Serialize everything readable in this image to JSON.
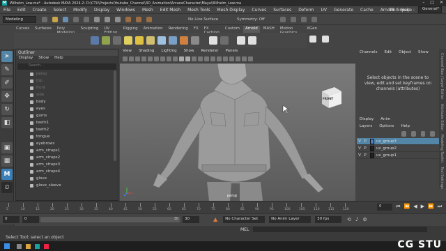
{
  "window": {
    "title": "Wilhelm_Low.ma* - Autodesk MAYA 2024.2: D:\\CTU\\Projects\\Youtube_Channel\\3D_Animation\\ArcaneCharacter\\Maya\\Wilhelm_Low.ma"
  },
  "menus": [
    "File",
    "Edit",
    "Create",
    "Select",
    "Modify",
    "Display",
    "Windows",
    "Mesh",
    "Edit Mesh",
    "Mesh Tools",
    "Mesh Display",
    "Curves",
    "Surfaces",
    "Deform",
    "UV",
    "Generate",
    "Cache",
    "Arnold",
    "Help"
  ],
  "workspace": {
    "label": "Workspace :",
    "value": "General*"
  },
  "statusline": {
    "mode": "Modeling",
    "live_surface": "No Live Surface",
    "symmetry": "Symmetry: Off"
  },
  "shelf_tabs": [
    "Curves",
    "Surfaces",
    "Poly Modeling",
    "Sculpting",
    "UV Editing",
    "Rigging",
    "Animation",
    "Rendering",
    "FX",
    "FX Caching",
    "Custom",
    "Arnold",
    "MASH",
    "Motion Graphics",
    "XGen"
  ],
  "shelf_active": "Arnold",
  "outliner": {
    "title": "Outliner",
    "menu": [
      "Display",
      "Show",
      "Help"
    ],
    "search_placeholder": "Search...",
    "items": [
      "persp",
      "top",
      "front",
      "side",
      "body",
      "eyes",
      "gums",
      "teeth1",
      "teeth2",
      "tongue",
      "eyebrows",
      "arm_straps1",
      "arm_straps2",
      "arm_straps3",
      "arm_straps4",
      "glove",
      "glove_sleeve"
    ],
    "dimmed": [
      "persp",
      "top",
      "front",
      "side"
    ]
  },
  "viewport": {
    "menu": [
      "View",
      "Shading",
      "Lighting",
      "Show",
      "Renderer",
      "Panels"
    ],
    "camera_label": "persp",
    "viewcube_label": "FRONT"
  },
  "channel_box": {
    "menu": [
      "Channels",
      "Edit",
      "Object",
      "Show"
    ],
    "message": "Select objects in the scene to view, edit and set keyframes on channels (attributes)"
  },
  "layer_editor": {
    "tabs": [
      "Display",
      "Anim"
    ],
    "menu": [
      "Layers",
      "Options",
      "Help"
    ],
    "layers": [
      {
        "v": "V",
        "p": "P",
        "name": "uv_group3",
        "color": "#4e7fbf",
        "selected": true
      },
      {
        "v": "V",
        "p": "P",
        "name": "uv_group2",
        "color": "#222222",
        "selected": false
      },
      {
        "v": "V",
        "p": "P",
        "name": "uv_group1",
        "color": "#222222",
        "selected": false
      }
    ]
  },
  "side_tabs": [
    "Channel Box / Layer Editor",
    "Attribute Editor",
    "Modeling Toolkit",
    "Tool Settings"
  ],
  "timeline": {
    "ticks": [
      "5",
      "10",
      "15",
      "20",
      "25",
      "30",
      "35",
      "40",
      "45",
      "50",
      "55",
      "60",
      "65",
      "70",
      "75",
      "80",
      "85",
      "90",
      "95",
      "100",
      "105",
      "110",
      "115",
      "120"
    ],
    "current_frame": "0"
  },
  "range": {
    "start": "0",
    "inner_start": "0",
    "inner_end": "30",
    "end": "30",
    "character_set": "No Character Set",
    "anim_layer": "No Anim Layer",
    "fps": "30 fps"
  },
  "command_line": {
    "label": "MEL"
  },
  "help_line": {
    "text": "Select Tool: select an object"
  },
  "watermark": {
    "text": "CG STU"
  }
}
